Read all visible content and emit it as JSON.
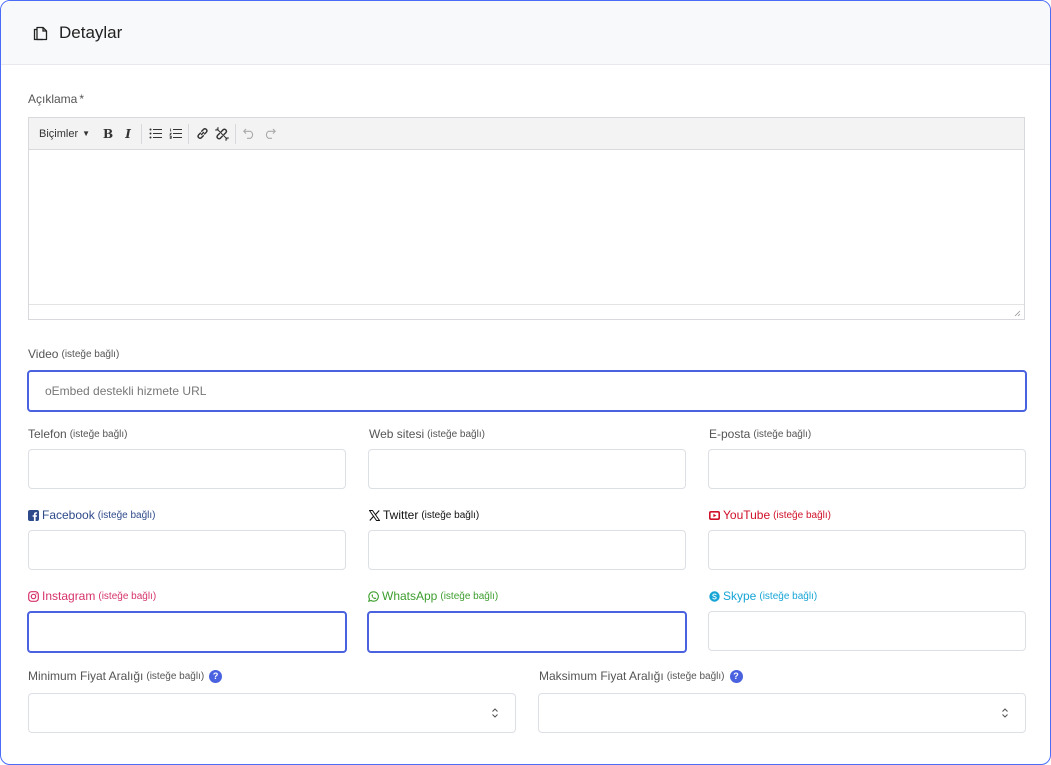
{
  "header": {
    "title": "Detaylar",
    "icon": "document-copy-icon"
  },
  "description": {
    "label": "Açıklama",
    "required_mark": "*",
    "toolbar": {
      "formats_label": "Biçimler",
      "bold": "B",
      "italic": "I"
    }
  },
  "optional_text": "(isteğe bağlı)",
  "video": {
    "label": "Video",
    "placeholder": "oEmbed destekli hizmete URL"
  },
  "phone": {
    "label": "Telefon"
  },
  "website": {
    "label": "Web sitesi"
  },
  "email": {
    "label": "E-posta"
  },
  "facebook": {
    "label": "Facebook",
    "color": "#2e4a8a",
    "icon": "facebook-icon"
  },
  "twitter": {
    "label": "Twitter",
    "color": "#111111",
    "icon": "x-icon"
  },
  "youtube": {
    "label": "YouTube",
    "color": "#d0102a",
    "icon": "youtube-icon"
  },
  "instagram": {
    "label": "Instagram",
    "color": "#d6336c",
    "icon": "instagram-icon"
  },
  "whatsapp": {
    "label": "WhatsApp",
    "color": "#3c9e2e",
    "icon": "whatsapp-icon"
  },
  "skype": {
    "label": "Skype",
    "color": "#17a5d6",
    "icon": "skype-icon"
  },
  "min_price": {
    "label": "Minimum Fiyat Aralığı",
    "help": "?"
  },
  "max_price": {
    "label": "Maksimum Fiyat Aralığı",
    "help": "?"
  },
  "colors": {
    "accent": "#4a62e0",
    "border": "#dcdfe4"
  }
}
